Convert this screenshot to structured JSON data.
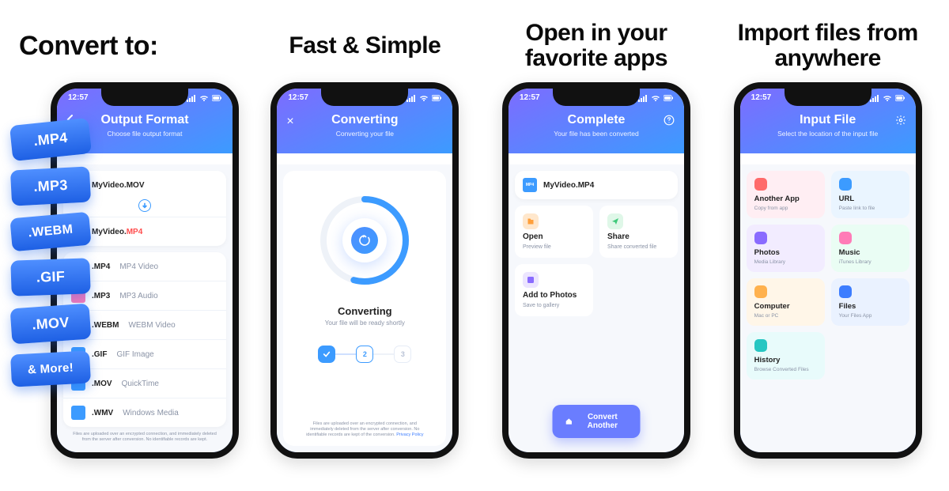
{
  "status_time": "12:57",
  "panes": [
    {
      "headline": "Convert to:",
      "pills": [
        ".MP4",
        ".MP3",
        ".WEBM",
        ".GIF",
        ".MOV",
        "& More!"
      ],
      "header": {
        "title": "Output Format",
        "subtitle": "Choose file output format"
      },
      "source_filename": "MyVideo.MOV",
      "target_filename_prefix": "MyVideo.",
      "target_filename_hi": "MP4",
      "formats": [
        {
          "ext": ".MP4",
          "desc": "MP4 Video",
          "icon": "blue"
        },
        {
          "ext": ".MP3",
          "desc": "MP3 Audio",
          "icon": "pink"
        },
        {
          "ext": ".WEBM",
          "desc": "WEBM Video",
          "icon": "teal"
        },
        {
          "ext": ".GIF",
          "desc": "GIF Image",
          "icon": "blue"
        },
        {
          "ext": ".MOV",
          "desc": "QuickTime",
          "icon": "blue"
        },
        {
          "ext": ".WMV",
          "desc": "Windows Media",
          "icon": "blue"
        }
      ],
      "disclaimer": "Files are uploaded over an encrypted connection, and immediately deleted from the server after conversion. No identifiable records are kept."
    },
    {
      "headline": "Fast & Simple",
      "header": {
        "title": "Converting",
        "subtitle": "Converting your file"
      },
      "status_title": "Converting",
      "status_sub": "Your file will be ready shortly",
      "steps": [
        "done",
        "2",
        "3"
      ],
      "disclaimer": "Files are uploaded over an encrypted connection, and immediately deleted from the server after conversion. No identifiable records are kept of the conversion.",
      "disclaimer_link": "Privacy Policy"
    },
    {
      "headline": "Open in your favorite apps",
      "header": {
        "title": "Complete",
        "subtitle": "Your file has been converted"
      },
      "result_filename": "MyVideo.MP4",
      "actions": [
        {
          "title": "Open",
          "sub": "Preview file",
          "color": "orange"
        },
        {
          "title": "Share",
          "sub": "Share converted file",
          "color": "green"
        },
        {
          "title": "Add to Photos",
          "sub": "Save to gallery",
          "color": "violet"
        }
      ],
      "cta": "Convert Another"
    },
    {
      "headline": "Import files from anywhere",
      "header": {
        "title": "Input File",
        "subtitle": "Select the location of the input file"
      },
      "sources": [
        {
          "title": "Another App",
          "sub": "Copy from app",
          "bg": "bg-pink",
          "ic": "sq-red"
        },
        {
          "title": "URL",
          "sub": "Paste link to file",
          "bg": "bg-sky",
          "ic": "sq-blue"
        },
        {
          "title": "Photos",
          "sub": "Media Library",
          "bg": "bg-lilac",
          "ic": "sq-violet"
        },
        {
          "title": "Music",
          "sub": "iTunes Library",
          "bg": "bg-mint",
          "ic": "sq-pink"
        },
        {
          "title": "Computer",
          "sub": "Mac or PC",
          "bg": "bg-sand",
          "ic": "sq-orange"
        },
        {
          "title": "Files",
          "sub": "Your Files App",
          "bg": "bg-ice",
          "ic": "sq-blue2"
        },
        {
          "title": "History",
          "sub": "Browse Converted Files",
          "bg": "bg-aqua",
          "ic": "sq-teal"
        }
      ]
    }
  ]
}
